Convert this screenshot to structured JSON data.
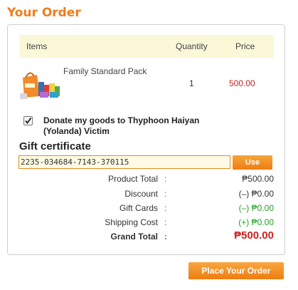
{
  "page": {
    "title": "Your Order"
  },
  "table": {
    "headers": {
      "items": "Items",
      "quantity": "Quantity",
      "price": "Price"
    },
    "rows": [
      {
        "name": "Family Standard Pack",
        "quantity": "1",
        "price": "500.00",
        "image_icon": "grocery-pack-image"
      }
    ]
  },
  "donate": {
    "checked": true,
    "label": "Donate my goods to Thyphoon Haiyan (Yolanda) Victim"
  },
  "gift": {
    "title": "Gift certificate",
    "value": "2235-034684-7143-370115",
    "use_label": "Use"
  },
  "summary": {
    "product_total": {
      "label": "Product Total",
      "value": "₱500.00"
    },
    "discount": {
      "label": "Discount",
      "value": "(–) ₱0.00"
    },
    "gift_cards": {
      "label": "Gift Cards",
      "value": "(–) ₱0.00"
    },
    "shipping_cost": {
      "label": "Shipping Cost",
      "value": "(+) ₱0.00"
    },
    "grand_total": {
      "label": "Grand Total",
      "value": "₱500.00"
    },
    "colon": ":"
  },
  "actions": {
    "place_order": "Place Your Order"
  },
  "colors": {
    "accent": "#ef7d1c",
    "price_red": "#c42020",
    "header_bg": "#fbf8d8"
  }
}
